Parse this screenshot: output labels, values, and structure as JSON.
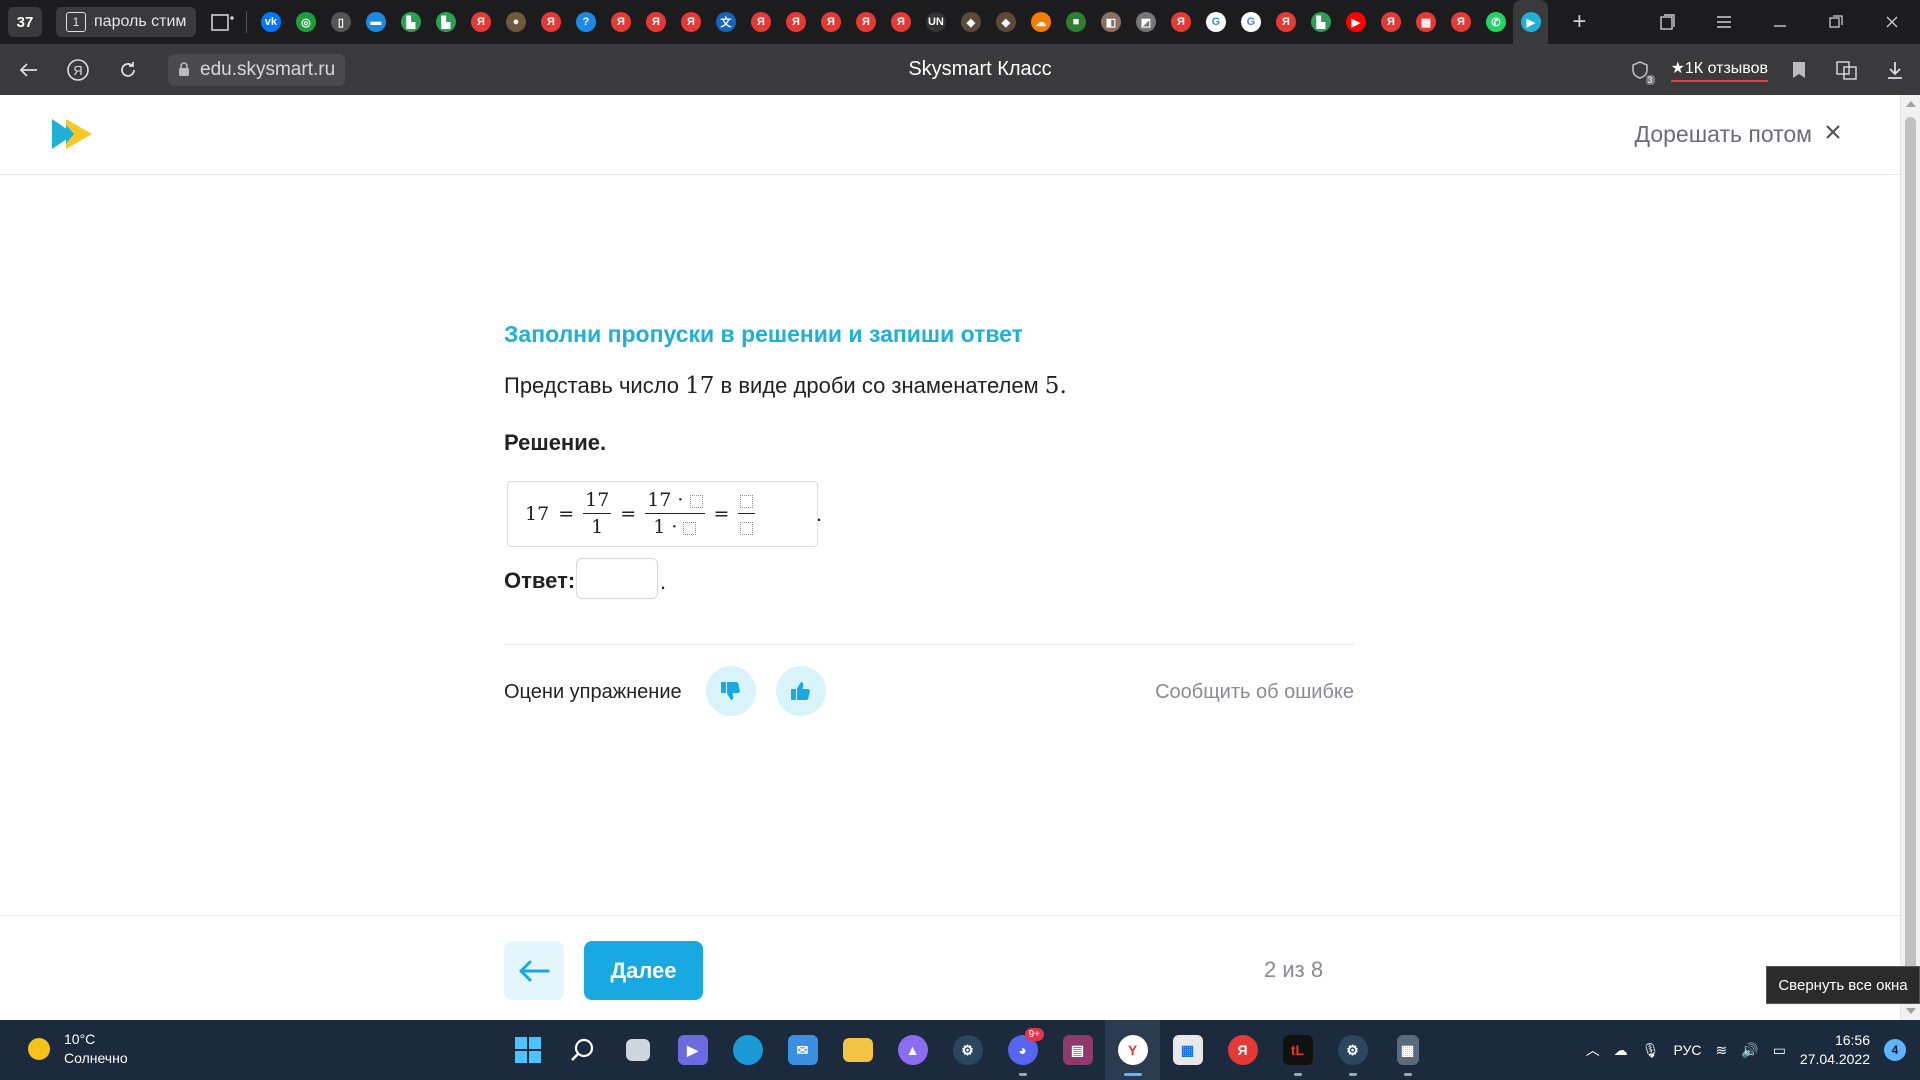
{
  "browser": {
    "tab_count": "37",
    "tab_group": {
      "number": "1",
      "label": "пароль стим"
    },
    "favicons": [
      {
        "icon": "vk-icon",
        "color": "#0077ff",
        "glyph": "vk"
      },
      {
        "icon": "green-circle-icon",
        "color": "#1e9e3e",
        "glyph": "◎"
      },
      {
        "icon": "document-icon",
        "color": "#555555",
        "glyph": "▯"
      },
      {
        "icon": "chat-icon",
        "color": "#1e88e5",
        "glyph": "▬"
      },
      {
        "icon": "tasks-icon",
        "color": "#2e9e55",
        "glyph": "▙"
      },
      {
        "icon": "tasks-icon",
        "color": "#2e9e55",
        "glyph": "▙"
      },
      {
        "icon": "yandex-icon",
        "color": "#e53935",
        "glyph": "Я"
      },
      {
        "icon": "game-icon",
        "color": "#6d5a3a",
        "glyph": "●"
      },
      {
        "icon": "yandex-icon",
        "color": "#e53935",
        "glyph": "Я"
      },
      {
        "icon": "question-icon",
        "color": "#1e88e5",
        "glyph": "?"
      },
      {
        "icon": "yandex-icon",
        "color": "#e53935",
        "glyph": "Я"
      },
      {
        "icon": "yandex-icon",
        "color": "#e53935",
        "glyph": "Я"
      },
      {
        "icon": "yandex-icon",
        "color": "#e53935",
        "glyph": "Я"
      },
      {
        "icon": "translate-icon",
        "color": "#1565c0",
        "glyph": "文"
      },
      {
        "icon": "yandex-icon",
        "color": "#e53935",
        "glyph": "Я"
      },
      {
        "icon": "yandex-icon",
        "color": "#e53935",
        "glyph": "Я"
      },
      {
        "icon": "yandex-icon",
        "color": "#e53935",
        "glyph": "Я"
      },
      {
        "icon": "yandex-icon",
        "color": "#e53935",
        "glyph": "Я"
      },
      {
        "icon": "yandex-icon",
        "color": "#e53935",
        "glyph": "Я"
      },
      {
        "icon": "un-icon",
        "color": "#333333",
        "glyph": "UN"
      },
      {
        "icon": "shield-icon",
        "color": "#5a4a3a",
        "glyph": "◆"
      },
      {
        "icon": "shield-icon",
        "color": "#5a4a3a",
        "glyph": "◆"
      },
      {
        "icon": "cloud-icon",
        "color": "#f57c00",
        "glyph": "☁"
      },
      {
        "icon": "square-icon",
        "color": "#2e7d32",
        "glyph": "■"
      },
      {
        "icon": "portrait-icon",
        "color": "#8d6e63",
        "glyph": "◧"
      },
      {
        "icon": "roblox-icon",
        "color": "#777777",
        "glyph": "◩"
      },
      {
        "icon": "yandex-icon",
        "color": "#e53935",
        "glyph": "Я"
      },
      {
        "icon": "google-icon",
        "color": "#ffffff",
        "glyph": "G"
      },
      {
        "icon": "google-icon",
        "color": "#ffffff",
        "glyph": "G"
      },
      {
        "icon": "yandex-icon",
        "color": "#e53935",
        "glyph": "Я"
      },
      {
        "icon": "tasks-icon",
        "color": "#2e9e55",
        "glyph": "▙"
      },
      {
        "icon": "youtube-icon",
        "color": "#ff0000",
        "glyph": "▶"
      },
      {
        "icon": "yandex-icon",
        "color": "#e53935",
        "glyph": "Я"
      },
      {
        "icon": "table-icon",
        "color": "#e53935",
        "glyph": "▦"
      },
      {
        "icon": "yandex-icon",
        "color": "#e53935",
        "glyph": "Я"
      },
      {
        "icon": "whatsapp-icon",
        "color": "#25d366",
        "glyph": "✆"
      },
      {
        "icon": "skysmart-icon",
        "color": "#1fb0d8",
        "glyph": "▶"
      }
    ],
    "url": "edu.skysmart.ru",
    "page_title": "Skysmart Класс",
    "reviews": "★1К отзывов",
    "extension_badge": "3"
  },
  "header": {
    "later_label": "Дорешать потом"
  },
  "task": {
    "title": "Заполни пропуски в решении и запиши ответ",
    "question_prefix": "Представь число ",
    "question_num": "17",
    "question_mid": " в виде дроби со знаменателем ",
    "question_den": "5",
    "question_end": ".",
    "solution_label": "Решение.",
    "math": {
      "lhs": "17",
      "f1_num": "17",
      "f1_den": "1",
      "f2_num_prefix": "17 ·",
      "f2_den_prefix": "1 ·"
    },
    "period": ".",
    "answer_label": "Ответ:",
    "answer_value": "",
    "answer_period": "."
  },
  "rating": {
    "label": "Оцени упражнение",
    "report_label": "Сообщить об ошибке"
  },
  "footer": {
    "next_label": "Далее",
    "progress": "2 из 8",
    "tooltip": "Свернуть все окна"
  },
  "taskbar": {
    "weather_temp": "10°C",
    "weather_desc": "Солнечно",
    "discord_badge": "9+",
    "lang": "РУС",
    "time": "16:56",
    "date": "27.04.2022",
    "notifications": "4"
  },
  "colors": {
    "accent": "#1fb0d8",
    "button": "#18a9e3",
    "button_light": "#d9f3fb"
  }
}
